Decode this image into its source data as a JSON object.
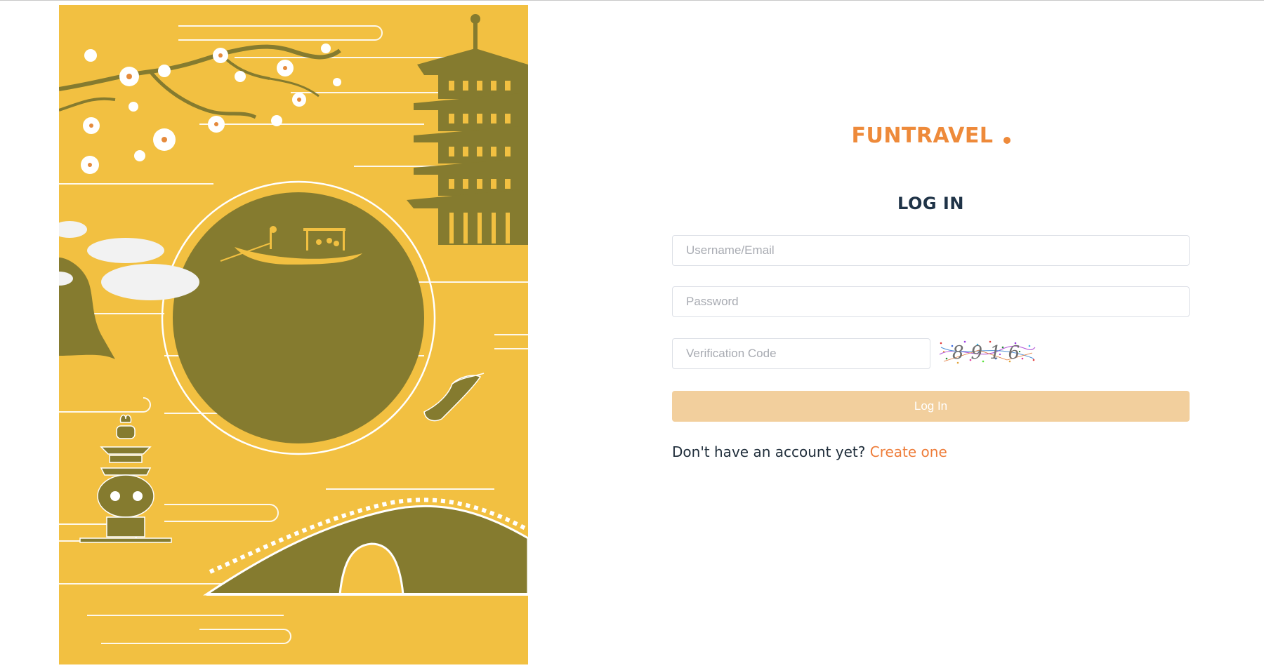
{
  "brand": {
    "name": "FUNTRAVEL"
  },
  "login": {
    "title": "LOG IN",
    "username_placeholder": "Username/Email",
    "password_placeholder": "Password",
    "code_placeholder": "Verification Code",
    "captcha_text": "8916",
    "submit_label": "Log In",
    "signup_prompt": "Don't have an account yet?",
    "signup_link": "Create one"
  },
  "colors": {
    "brand_accent": "#ee8a3a",
    "illustration_bg": "#f2c041",
    "illustration_dark": "#857b2f",
    "button_bg": "#f2cf9d",
    "title_text": "#1f3347",
    "link": "#ee7d3a"
  }
}
